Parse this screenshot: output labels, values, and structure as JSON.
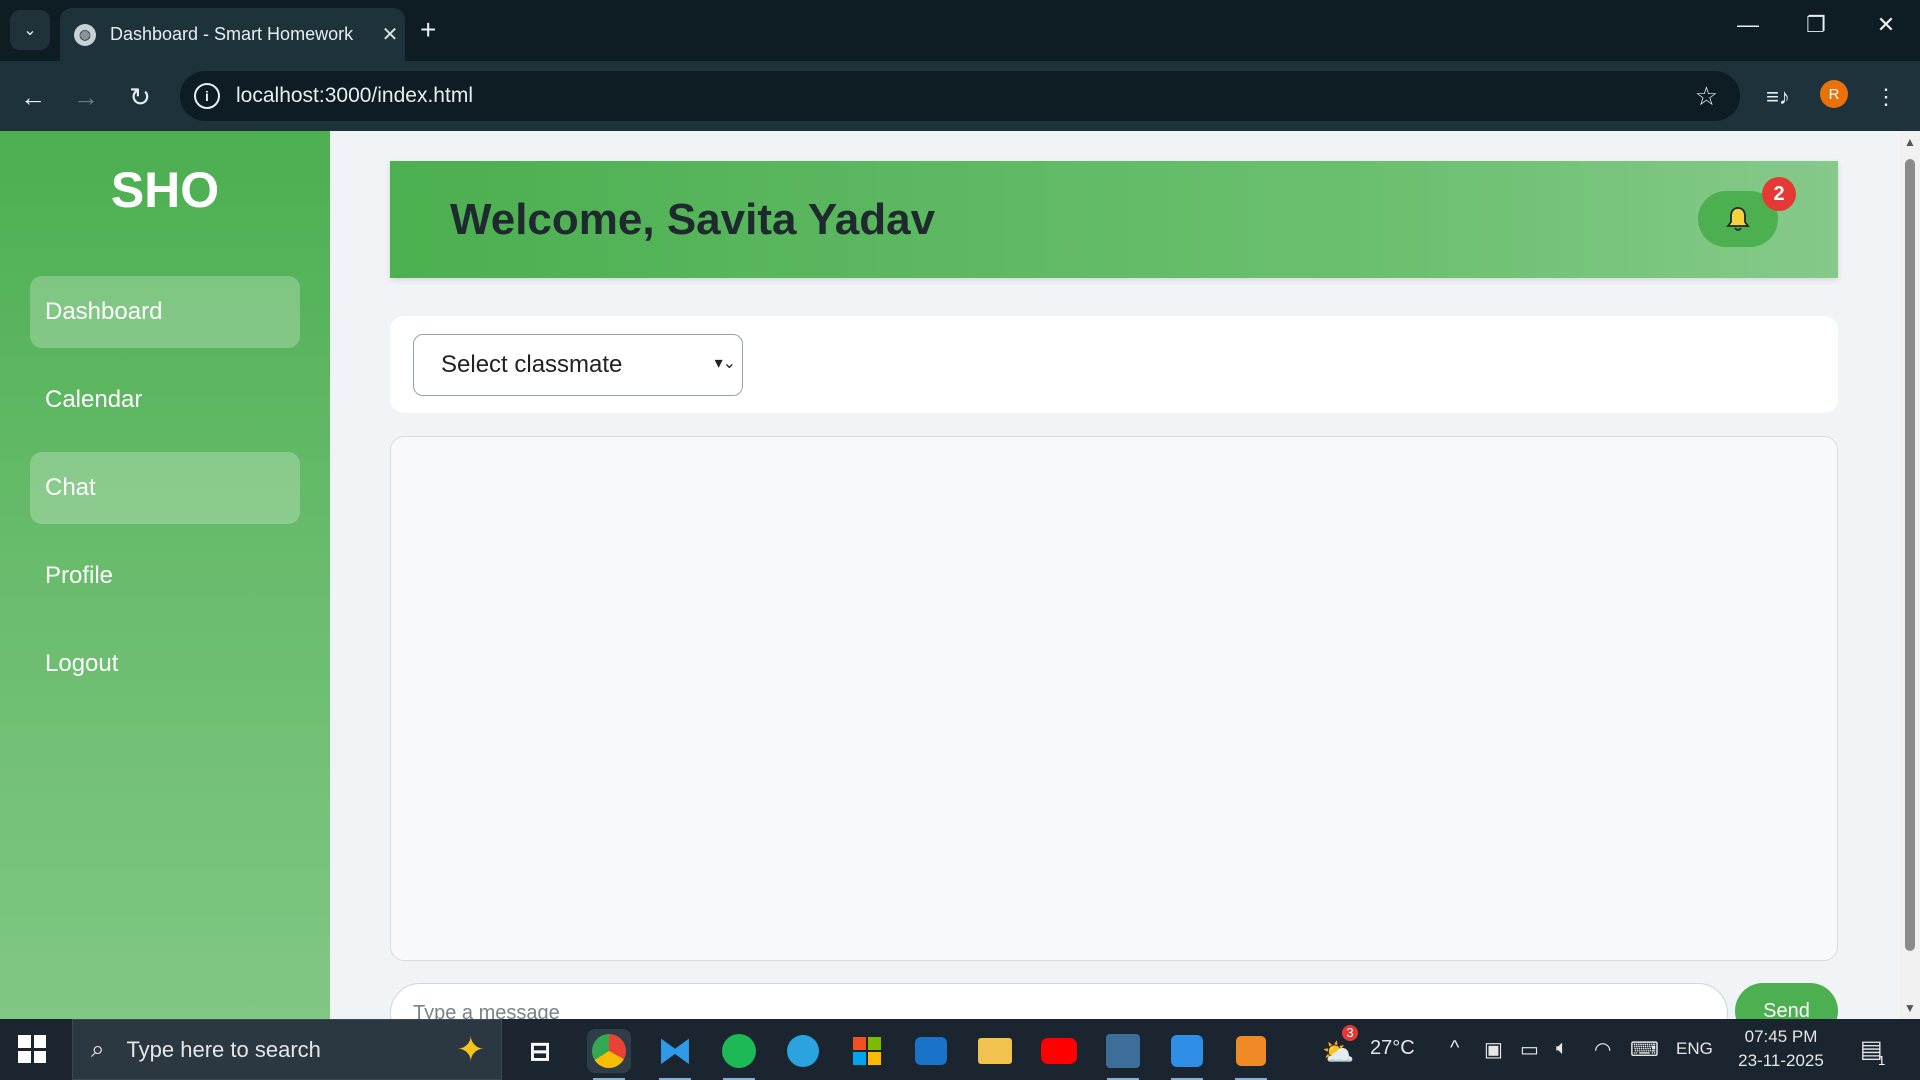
{
  "browser": {
    "tab_title": "Dashboard - Smart Homework",
    "tab_close": "✕",
    "new_tab": "+",
    "url": "localhost:3000/index.html",
    "profile_initial": "R",
    "back": "←",
    "forward": "→",
    "reload": "↻",
    "star": "☆",
    "menu": "⋮",
    "media": "≡♪",
    "minimize": "—",
    "restore": "❐",
    "close": "✕"
  },
  "sidebar": {
    "brand": "SHO",
    "items": [
      {
        "label": "Dashboard"
      },
      {
        "label": "Calendar"
      },
      {
        "label": "Chat"
      },
      {
        "label": "Profile"
      },
      {
        "label": "Logout"
      }
    ]
  },
  "header": {
    "welcome": "Welcome, Savita Yadav",
    "notification_count": "2"
  },
  "chat": {
    "select_placeholder": "Select classmate",
    "message_placeholder": "Type a message",
    "send_label": "Send"
  },
  "taskbar": {
    "search_placeholder": "Type here to search",
    "weather": "27°C",
    "weather_badge": "3",
    "language": "ENG",
    "time": "07:45 PM",
    "date": "23-11-2025",
    "notification_count": "1"
  },
  "colors": {
    "primary_green": "#4caf50",
    "badge_red": "#e53935"
  }
}
